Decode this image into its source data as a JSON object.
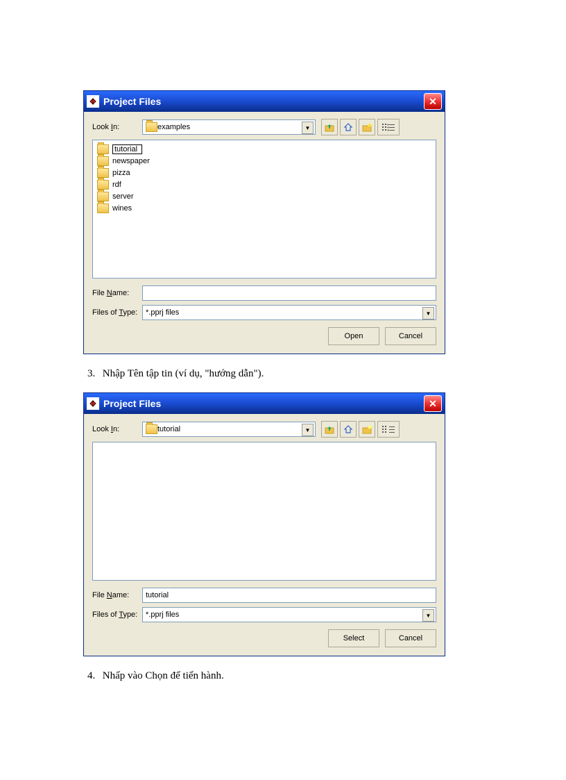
{
  "dialog1": {
    "title": "Project Files",
    "lookin_label": "Look In:",
    "lookin_value": "examples",
    "files": [
      "tutorial",
      "newspaper",
      "pizza",
      "rdf",
      "server",
      "wines"
    ],
    "filename_label": "File Name:",
    "filename_value": "",
    "filetype_label": "Files of Type:",
    "filetype_value": "*.pprj files",
    "btn_primary": "Open",
    "btn_cancel": "Cancel"
  },
  "step3": {
    "num": "3.",
    "text": "Nhập Tên tập tin (ví dụ, \"hướng dẫn\")."
  },
  "dialog2": {
    "title": "Project Files",
    "lookin_label": "Look In:",
    "lookin_value": "tutorial",
    "filename_label": "File Name:",
    "filename_value": "tutorial",
    "filetype_label": "Files of Type:",
    "filetype_value": "*.pprj files",
    "btn_primary": "Select",
    "btn_cancel": "Cancel"
  },
  "step4": {
    "num": "4.",
    "text": "Nhấp vào Chọn để tiến hành."
  },
  "labels": {
    "lookin_N": "N",
    "filetype_T": "T",
    "lookin_rest": "ame:",
    "filetype_rest": "ype:"
  }
}
